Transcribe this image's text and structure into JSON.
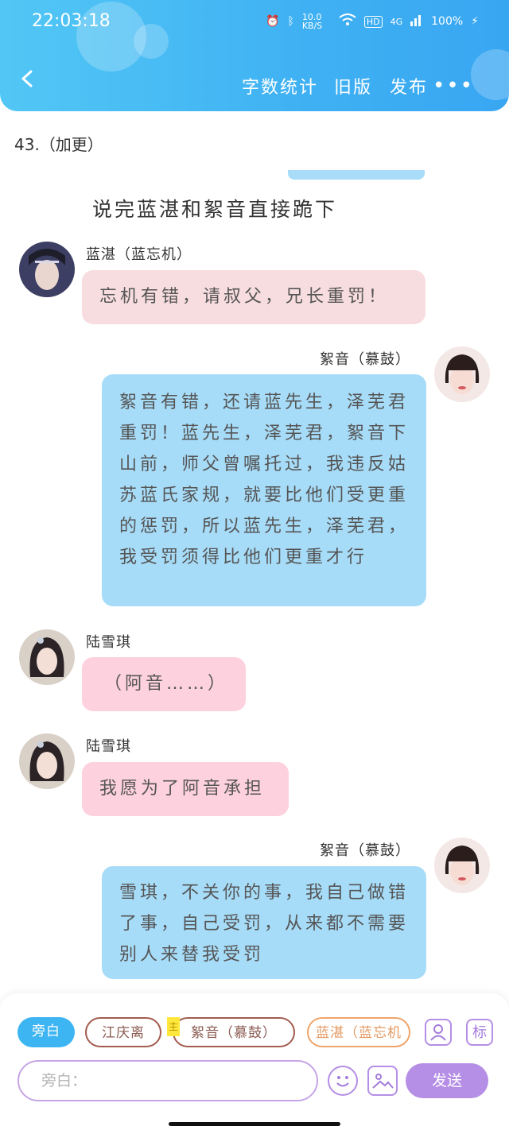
{
  "status_bar": {
    "time": "22:03:18",
    "network_speed": "10.0 KB/S",
    "hd": "HD",
    "signal": "4G",
    "battery": "100%"
  },
  "header": {
    "nav": [
      "字数统计",
      "旧版",
      "发布"
    ],
    "more": "•••"
  },
  "chapter_title": "43.（加更）",
  "narration": "说完蓝湛和絮音直接跪下",
  "messages": [
    {
      "side": "left",
      "name": "蓝湛（蓝忘机）",
      "text": "忘机有错，请叔父，兄长重罚！"
    },
    {
      "side": "right",
      "name": "絮音（慕鼓）",
      "text": "絮音有错，还请蓝先生，泽芜君重罚！蓝先生，泽芜君，絮音下山前，师父曾嘱托过，我违反姑苏蓝氏家规，就要比他们受更重的惩罚，所以蓝先生，泽芜君，我受罚须得比他们更重才行"
    },
    {
      "side": "left",
      "name": "陆雪琪",
      "text": "（阿音……）"
    },
    {
      "side": "left",
      "name": "陆雪琪",
      "text": "我愿为了阿音承担"
    },
    {
      "side": "right",
      "name": "絮音（慕鼓）",
      "text": "雪琪，不关你的事，我自己做错了事，自己受罚，从来都不需要别人来替我受罚"
    }
  ],
  "roles": {
    "narrator": "旁白",
    "role1": "江庆离",
    "star": "主",
    "role2": "絮音（慕鼓）",
    "role3": "蓝湛（蓝忘机"
  },
  "tool_label": "标",
  "input": {
    "placeholder": "旁白："
  },
  "send_label": "发送",
  "colors": {
    "header": "#3fb1f3",
    "pink_bubble": "#f7dde0",
    "pinker_bubble": "#fdd1dd",
    "blue_bubble": "#a7dcf8",
    "accent_purple": "#b58ee6"
  }
}
